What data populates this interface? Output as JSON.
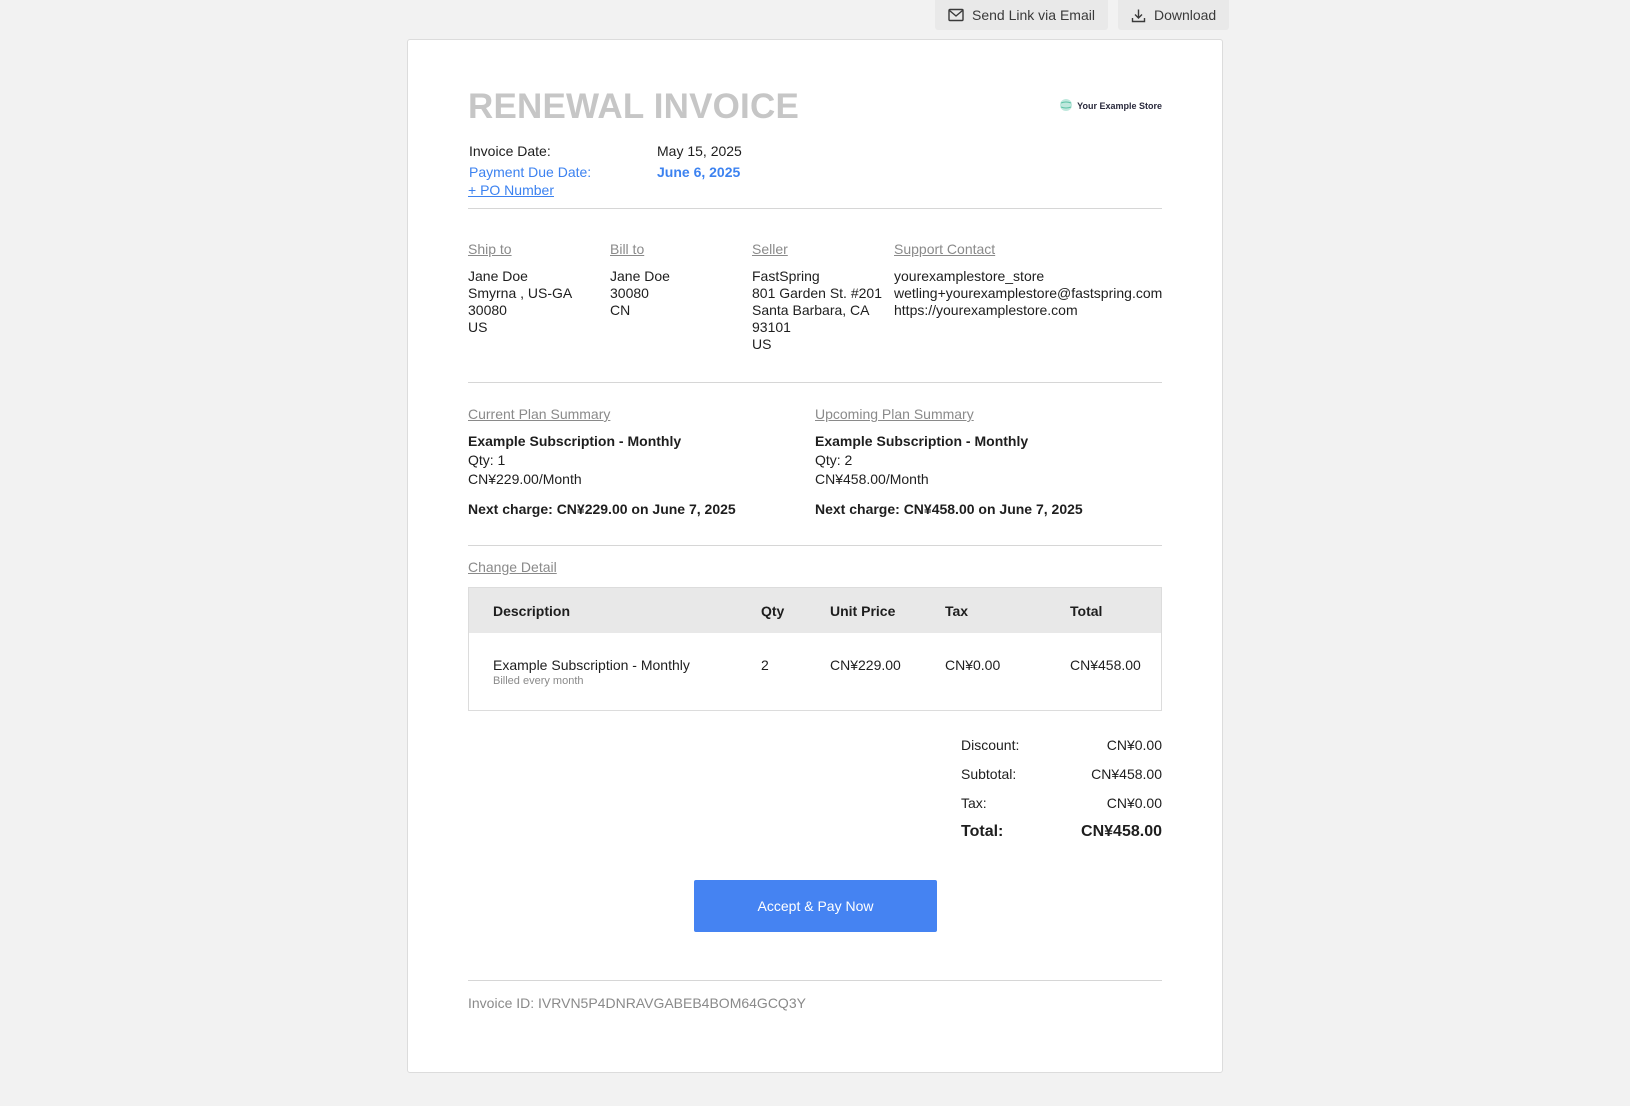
{
  "toolbar": {
    "send_label": "Send Link via Email",
    "download_label": "Download"
  },
  "header": {
    "title": "RENEWAL INVOICE",
    "logo_text": "Your Example Store",
    "invoice_date_label": "Invoice Date:",
    "invoice_date": "May 15, 2025",
    "due_date_label": "Payment Due Date:",
    "due_date": "June 6, 2025",
    "po_link": "+ PO Number"
  },
  "addresses": {
    "ship_to": {
      "heading": "Ship to",
      "lines": [
        "Jane Doe",
        "Smyrna , US-GA",
        "30080",
        "US"
      ]
    },
    "bill_to": {
      "heading": "Bill to",
      "lines": [
        "Jane Doe",
        "30080",
        "CN"
      ]
    },
    "seller": {
      "heading": "Seller",
      "lines": [
        "FastSpring",
        "801 Garden St. #201",
        "Santa Barbara, CA",
        "93101",
        "US"
      ]
    },
    "support": {
      "heading": "Support Contact",
      "lines": [
        "yourexamplestore_store",
        "wetling+yourexamplestore@fastspring.com",
        "https://yourexamplestore.com"
      ]
    }
  },
  "plans": {
    "current": {
      "heading": "Current Plan Summary",
      "name": "Example Subscription - Monthly",
      "qty": "Qty: 1",
      "price": "CN¥229.00/Month",
      "next": "Next charge: CN¥229.00 on June 7, 2025"
    },
    "upcoming": {
      "heading": "Upcoming Plan Summary",
      "name": "Example Subscription - Monthly",
      "qty": "Qty: 2",
      "price": "CN¥458.00/Month",
      "next": "Next charge: CN¥458.00 on June 7, 2025"
    }
  },
  "change": {
    "heading": "Change Detail",
    "columns": [
      "Description",
      "Qty",
      "Unit Price",
      "Tax",
      "Total"
    ],
    "rows": [
      {
        "description": "Example Subscription - Monthly",
        "sub": "Billed every month",
        "qty": "2",
        "unit_price": "CN¥229.00",
        "tax": "CN¥0.00",
        "total": "CN¥458.00"
      }
    ]
  },
  "totals": {
    "discount_label": "Discount:",
    "discount": "CN¥0.00",
    "subtotal_label": "Subtotal:",
    "subtotal": "CN¥458.00",
    "tax_label": "Tax:",
    "tax": "CN¥0.00",
    "total_label": "Total:",
    "total": "CN¥458.00"
  },
  "pay_button": "Accept & Pay Now",
  "invoice_id": "Invoice ID: IVRVN5P4DNRAVGABEB4BOM64GCQ3Y",
  "colors": {
    "accent": "#4583f2",
    "link": "#3c82f0",
    "title": "#c6c6c6"
  }
}
